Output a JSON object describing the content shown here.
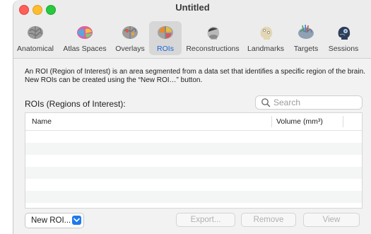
{
  "window": {
    "title": "Untitled"
  },
  "toolbar": {
    "items": [
      {
        "label": "Anatomical",
        "icon": "brain-gray-icon"
      },
      {
        "label": "Atlas Spaces",
        "icon": "brain-atlas-icon"
      },
      {
        "label": "Overlays",
        "icon": "brain-overlay-icon"
      },
      {
        "label": "ROIs",
        "icon": "brain-roi-icon",
        "selected": true
      },
      {
        "label": "Reconstructions",
        "icon": "head-reconstruction-icon"
      },
      {
        "label": "Landmarks",
        "icon": "head-landmark-icon"
      },
      {
        "label": "Targets",
        "icon": "brain-target-icon"
      },
      {
        "label": "Sessions",
        "icon": "head-session-icon"
      }
    ]
  },
  "content": {
    "description": "An ROI (Region of Interest) is an area segmented from a data set that identifies a specific region of the brain. New ROIs can be created using the “New ROI…” button.",
    "heading": "ROIs (Regions of Interest):",
    "search": {
      "placeholder": "Search",
      "value": ""
    },
    "table": {
      "columns": [
        "Name",
        "Volume (mm³)"
      ],
      "rows": []
    },
    "buttons": {
      "new_roi": "New ROI...",
      "export": "Export...",
      "remove": "Remove",
      "view": "View"
    }
  },
  "colors": {
    "accent": "#1f7aeb",
    "close": "#ff5f57",
    "minimize": "#febc2e",
    "maximize": "#28c840"
  }
}
